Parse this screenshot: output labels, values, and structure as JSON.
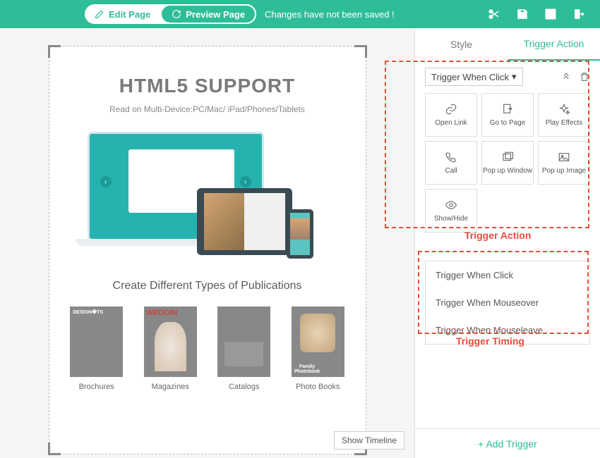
{
  "toolbar": {
    "edit_label": "Edit Page",
    "preview_label": "Preview Page",
    "save_status": "Changes have not been saved !"
  },
  "canvas": {
    "title": "HTML5 SUPPORT",
    "subtitle": "Read on Multi-Device:PC/Mac/ iPad/Phones/Tablets",
    "heading2": "Create Different Types of Publications",
    "pubs": [
      {
        "label": "Brochures"
      },
      {
        "label": "Magazines"
      },
      {
        "label": "Catalogs"
      },
      {
        "label": "Photo Books"
      }
    ],
    "show_timeline": "Show Timeline"
  },
  "sidebar": {
    "tabs": {
      "style": "Style",
      "trigger": "Trigger Action"
    },
    "trigger_dropdown": "Trigger When Click",
    "actions": [
      {
        "label": "Open Link"
      },
      {
        "label": "Go to Page"
      },
      {
        "label": "Play Effects"
      },
      {
        "label": "Call"
      },
      {
        "label": "Pop up Window"
      },
      {
        "label": "Pop up Image"
      },
      {
        "label": "Show/Hide"
      }
    ],
    "timing": [
      "Trigger When Click",
      "Trigger When Mouseover",
      "Trigger When Mouseleave"
    ],
    "add_trigger": "+ Add Trigger"
  },
  "annotations": {
    "action": "Trigger Action",
    "timing": "Trigger Timing"
  }
}
